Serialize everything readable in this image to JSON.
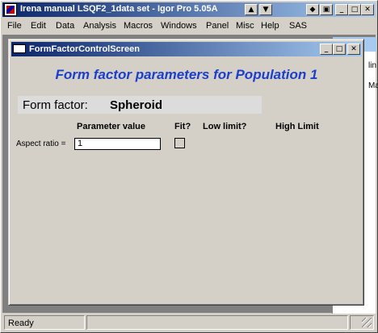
{
  "app": {
    "title": "Irena manual LSQF2_1data set - Igor Pro 5.05A",
    "icon": "igor-app-icon"
  },
  "title_buttons": {
    "restore_down": "▲",
    "window": "☐",
    "minimize": "_",
    "maximize": "□",
    "close": "✕",
    "left_arrow": "◆",
    "save": "▣"
  },
  "menu": {
    "items": [
      "File",
      "Edit",
      "Data",
      "Analysis",
      "Macros",
      "Windows",
      "Panel",
      "Misc",
      "Help",
      "SAS"
    ]
  },
  "bg_window": {
    "text1": "lin",
    "text2": "Max"
  },
  "child_window": {
    "title": "FormFactorControlScreen",
    "minimize": "_",
    "maximize": "□",
    "close": "✕"
  },
  "panel": {
    "heading": "Form factor parameters for Population 1",
    "form_factor_label": "Form factor:",
    "form_factor_value": "Spheroid",
    "columns": {
      "parameter_value": "Parameter value",
      "fit": "Fit?",
      "low_limit": "Low limit?",
      "high_limit": "High Limit"
    },
    "aspect_ratio": {
      "label": "Aspect ratio =",
      "value": "1",
      "fit_checked": false
    }
  },
  "status": {
    "text": "Ready"
  }
}
